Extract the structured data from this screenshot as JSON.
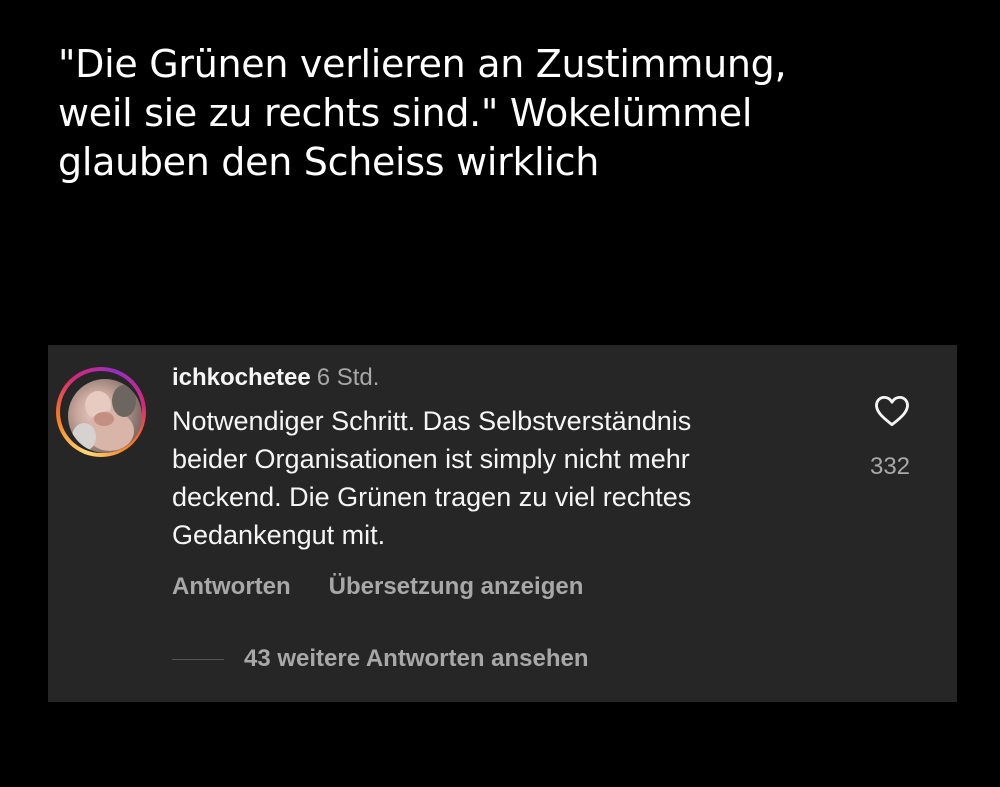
{
  "caption": {
    "line1": "\"Die Grünen verlieren an Zustimmung,",
    "line2": "weil sie zu rechts sind.\" Wokelümmel",
    "line3": "glauben den Scheiss wirklich"
  },
  "comment": {
    "username": "ichkochetee",
    "timestamp": "6 Std.",
    "text_lines": [
      "Notwendiger Schritt. Das Selbstverständnis",
      "beider Organisationen ist simply nicht mehr",
      "deckend. Die Grünen tragen zu viel rechtes",
      "Gedankengut mit."
    ],
    "like_icon": "heart-outline-icon",
    "like_count": "332",
    "reply_label": "Antworten",
    "translate_label": "Übersetzung anzeigen",
    "more_replies_label": "43 weitere Antworten ansehen"
  },
  "colors": {
    "background": "#000000",
    "card_background": "#262626",
    "primary_text": "#f5f5f5",
    "secondary_text": "#a8a8a8",
    "story_ring": [
      "#feda75",
      "#fa7e1e",
      "#d62976",
      "#962fbf"
    ]
  }
}
